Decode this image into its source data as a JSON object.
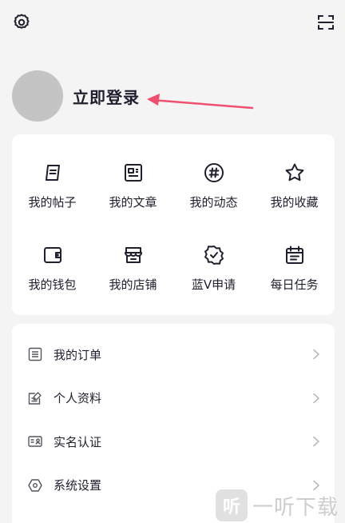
{
  "header": {
    "settings_icon": "gear-icon",
    "scan_icon": "scan-icon"
  },
  "profile": {
    "login_label": "立即登录",
    "arrow_color": "#f0506e"
  },
  "quick_grid": {
    "items": [
      {
        "label": "我的帖子",
        "icon": "post-icon"
      },
      {
        "label": "我的文章",
        "icon": "article-icon"
      },
      {
        "label": "我的动态",
        "icon": "hashtag-icon"
      },
      {
        "label": "我的收藏",
        "icon": "star-icon"
      },
      {
        "label": "我的钱包",
        "icon": "wallet-icon"
      },
      {
        "label": "我的店铺",
        "icon": "store-icon"
      },
      {
        "label": "蓝V申请",
        "icon": "verified-badge-icon"
      },
      {
        "label": "每日任务",
        "icon": "calendar-icon"
      }
    ]
  },
  "menu_list": {
    "items": [
      {
        "label": "我的订单",
        "icon": "order-icon"
      },
      {
        "label": "个人资料",
        "icon": "profile-edit-icon"
      },
      {
        "label": "实名认证",
        "icon": "id-card-icon"
      },
      {
        "label": "系统设置",
        "icon": "hexagon-settings-icon"
      }
    ]
  },
  "watermark": {
    "logo_char": "听",
    "text": "一听下载"
  }
}
